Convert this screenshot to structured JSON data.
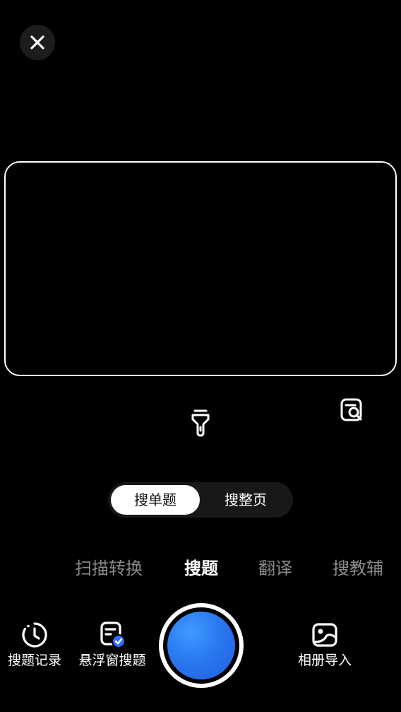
{
  "header": {
    "close_icon": "close-icon"
  },
  "camera": {
    "flashlight_icon": "flashlight-icon",
    "scan_search_icon": "document-search-icon"
  },
  "segment": {
    "options": [
      "搜单题",
      "搜整页"
    ],
    "selected": "搜单题"
  },
  "modes": {
    "items": [
      "扫描转换",
      "搜题",
      "翻译",
      "搜教辅"
    ],
    "active": "搜题"
  },
  "toolbar": {
    "history_label": "搜题记录",
    "history_icon": "clock-history-icon",
    "float_label": "悬浮窗搜题",
    "float_icon": "floating-window-icon",
    "album_label": "相册导入",
    "album_icon": "photo-album-icon"
  },
  "colors": {
    "background": "#000000",
    "shutter_blue": "#2a78f0",
    "badge_blue": "#2f6bff",
    "inactive_text": "#8a8a8a"
  }
}
